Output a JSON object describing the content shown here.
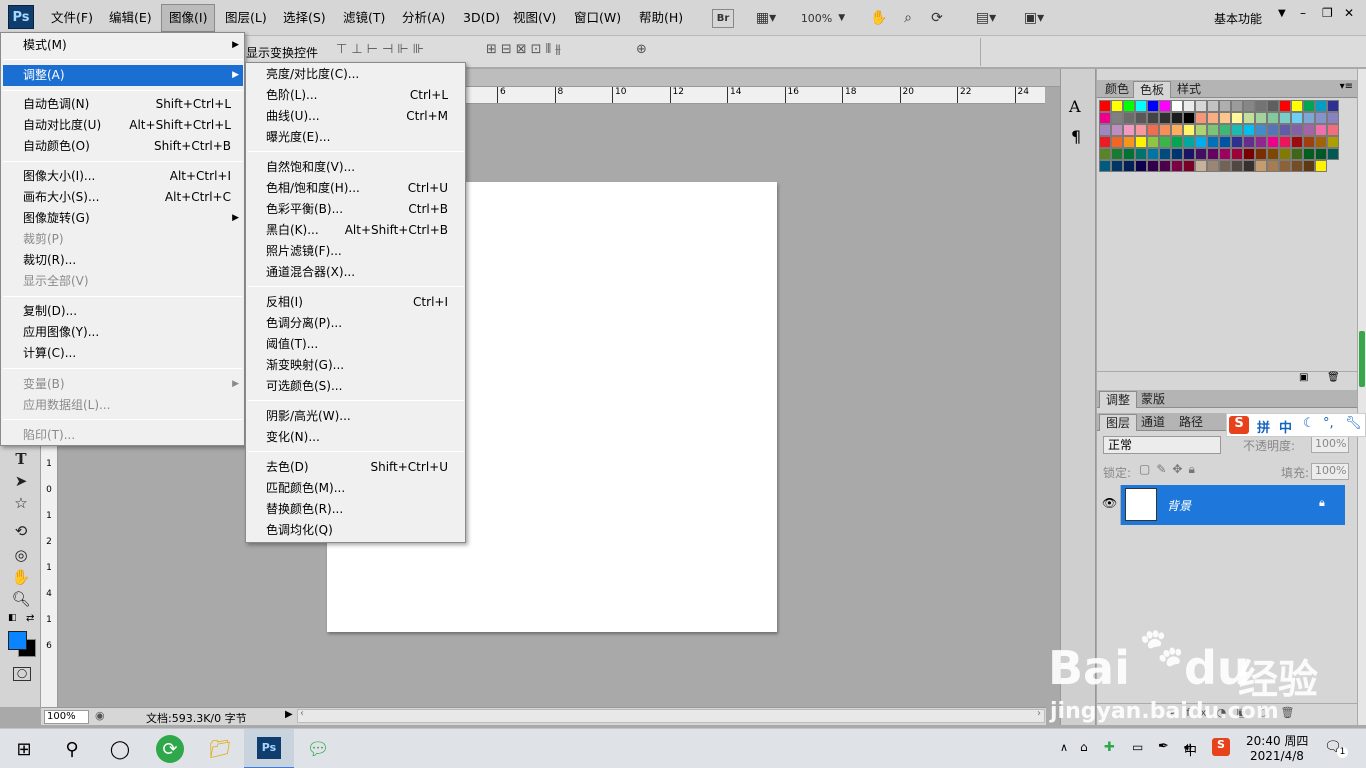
{
  "menubar": {
    "logo": "Ps",
    "items": [
      "文件(F)",
      "编辑(E)",
      "图像(I)",
      "图层(L)",
      "选择(S)",
      "滤镜(T)",
      "分析(A)",
      "3D(D)",
      "视图(V)",
      "窗口(W)",
      "帮助(H)"
    ],
    "bridge_label": "Br",
    "zoom": "100%",
    "workspace": "基本功能"
  },
  "options_bar": {
    "transform_label": "显示变换控件"
  },
  "rulers": {
    "top_ticks": [
      "6",
      "8",
      "10",
      "12",
      "14",
      "16",
      "18",
      "20",
      "22",
      "24"
    ],
    "left_ticks": [
      "1",
      "0",
      "1",
      "2",
      "1",
      "4",
      "1",
      "6"
    ]
  },
  "image_menu": {
    "items": [
      {
        "label": "模式(M)",
        "shortcut": "",
        "submenu": true,
        "disabled": false
      },
      {
        "label": "调整(A)",
        "shortcut": "",
        "submenu": true,
        "disabled": false,
        "highlighted": true
      },
      {
        "label": "自动色调(N)",
        "shortcut": "Shift+Ctrl+L",
        "disabled": false
      },
      {
        "label": "自动对比度(U)",
        "shortcut": "Alt+Shift+Ctrl+L",
        "disabled": false
      },
      {
        "label": "自动颜色(O)",
        "shortcut": "Shift+Ctrl+B",
        "disabled": false
      },
      {
        "label": "图像大小(I)...",
        "shortcut": "Alt+Ctrl+I",
        "disabled": false
      },
      {
        "label": "画布大小(S)...",
        "shortcut": "Alt+Ctrl+C",
        "disabled": false
      },
      {
        "label": "图像旋转(G)",
        "shortcut": "",
        "submenu": true,
        "disabled": false
      },
      {
        "label": "裁剪(P)",
        "shortcut": "",
        "disabled": true
      },
      {
        "label": "裁切(R)...",
        "shortcut": "",
        "disabled": false
      },
      {
        "label": "显示全部(V)",
        "shortcut": "",
        "disabled": true
      },
      {
        "label": "复制(D)...",
        "shortcut": "",
        "disabled": false
      },
      {
        "label": "应用图像(Y)...",
        "shortcut": "",
        "disabled": false
      },
      {
        "label": "计算(C)...",
        "shortcut": "",
        "disabled": false
      },
      {
        "label": "变量(B)",
        "shortcut": "",
        "submenu": true,
        "disabled": true
      },
      {
        "label": "应用数据组(L)...",
        "shortcut": "",
        "disabled": true
      },
      {
        "label": "陷印(T)...",
        "shortcut": "",
        "disabled": true
      }
    ]
  },
  "adjust_submenu": {
    "items": [
      {
        "label": "亮度/对比度(C)...",
        "shortcut": ""
      },
      {
        "label": "色阶(L)...",
        "shortcut": "Ctrl+L"
      },
      {
        "label": "曲线(U)...",
        "shortcut": "Ctrl+M"
      },
      {
        "label": "曝光度(E)...",
        "shortcut": ""
      },
      {
        "label": "自然饱和度(V)...",
        "shortcut": ""
      },
      {
        "label": "色相/饱和度(H)...",
        "shortcut": "Ctrl+U"
      },
      {
        "label": "色彩平衡(B)...",
        "shortcut": "Ctrl+B"
      },
      {
        "label": "黑白(K)...",
        "shortcut": "Alt+Shift+Ctrl+B"
      },
      {
        "label": "照片滤镜(F)...",
        "shortcut": ""
      },
      {
        "label": "通道混合器(X)...",
        "shortcut": ""
      },
      {
        "label": "反相(I)",
        "shortcut": "Ctrl+I"
      },
      {
        "label": "色调分离(P)...",
        "shortcut": ""
      },
      {
        "label": "阈值(T)...",
        "shortcut": ""
      },
      {
        "label": "渐变映射(G)...",
        "shortcut": ""
      },
      {
        "label": "可选颜色(S)...",
        "shortcut": ""
      },
      {
        "label": "阴影/高光(W)...",
        "shortcut": ""
      },
      {
        "label": "变化(N)...",
        "shortcut": ""
      },
      {
        "label": "去色(D)",
        "shortcut": "Shift+Ctrl+U"
      },
      {
        "label": "匹配颜色(M)...",
        "shortcut": ""
      },
      {
        "label": "替换颜色(R)...",
        "shortcut": ""
      },
      {
        "label": "色调均化(Q)",
        "shortcut": ""
      }
    ]
  },
  "color_panel": {
    "tabs": [
      "颜色",
      "色板",
      "样式"
    ],
    "swatch_colors": [
      "#ff0000",
      "#ffff00",
      "#00ff00",
      "#00ffff",
      "#0000ff",
      "#ff00ff",
      "#ffffff",
      "#ebebeb",
      "#d7d7d7",
      "#c3c3c3",
      "#afafaf",
      "#9b9b9b",
      "#878787",
      "#737373",
      "#5f5f5f",
      "#ff0000",
      "#ffff00",
      "#00a651",
      "#00a0c6",
      "#2e3192",
      "#ec008c",
      "#808080",
      "#6c6c6c",
      "#585858",
      "#444444",
      "#303030",
      "#1c1c1c",
      "#000000",
      "#f7977a",
      "#f9ad81",
      "#fdc68a",
      "#fff79a",
      "#c4df9b",
      "#a3d39c",
      "#82ca9d",
      "#7bcdc8",
      "#6ecff6",
      "#7ea7d8",
      "#8493ca",
      "#8882be",
      "#a187be",
      "#bc8dbf",
      "#f49ac2",
      "#f6989d",
      "#f26c4f",
      "#f68e55",
      "#fbaf5c",
      "#fff467",
      "#acd372",
      "#7cc576",
      "#3bb878",
      "#1abbb4",
      "#00bff3",
      "#438ccb",
      "#5574b9",
      "#605ca8",
      "#855fa8",
      "#a763a8",
      "#f06ea9",
      "#f26d7d",
      "#ed1c24",
      "#f26522",
      "#f7941d",
      "#fff200",
      "#8dc73f",
      "#39b54a",
      "#00a651",
      "#00a99d",
      "#00aeef",
      "#0072bc",
      "#0054a6",
      "#2e3192",
      "#662d91",
      "#92278f",
      "#ec008c",
      "#ed145b",
      "#9e0b0f",
      "#a0410d",
      "#a36209",
      "#aba000",
      "#598527",
      "#1a7b30",
      "#007236",
      "#00746b",
      "#0076a3",
      "#004b80",
      "#003471",
      "#1b1464",
      "#440e62",
      "#630460",
      "#9e005d",
      "#9e0039",
      "#790000",
      "#7b2e00",
      "#7d4900",
      "#827b00",
      "#406618",
      "#005e20",
      "#005826",
      "#005952",
      "#005b7f",
      "#003663",
      "#002157",
      "#0d004c",
      "#32004b",
      "#4b0049",
      "#7b0046",
      "#7a0026",
      "#c7b299",
      "#998675",
      "#736357",
      "#534741",
      "#37302d",
      "#c69c6d",
      "#a67c52",
      "#8c6239",
      "#754c24",
      "#603913",
      "#fff200"
    ]
  },
  "adjust_panel": {
    "tabs": [
      "调整",
      "蒙版"
    ]
  },
  "layers_panel": {
    "tabs": [
      "图层",
      "通道",
      "路径"
    ],
    "blend_mode": "正常",
    "opacity_label": "不透明度:",
    "opacity_value": "100%",
    "lock_label": "锁定:",
    "fill_label": "填充:",
    "fill_value": "100%",
    "layer_name": "背景"
  },
  "ime_bar": {
    "items": [
      "拼",
      "中"
    ]
  },
  "status": {
    "zoom": "100%",
    "doc_info": "文档:593.3K/0 字节"
  },
  "watermark": {
    "brand": "Bai",
    "brand2": "du",
    "cn": "经验",
    "url": "jingyan.baidu.com"
  },
  "taskbar": {
    "time": "20:40 周四",
    "date": "2021/4/8",
    "ime": "中",
    "notify_count": "1"
  },
  "colors": {
    "highlight": "#1c6fd2",
    "layer_selected": "#1e78dc",
    "fg_color": "#0a84ff",
    "bg_color": "#000000"
  }
}
